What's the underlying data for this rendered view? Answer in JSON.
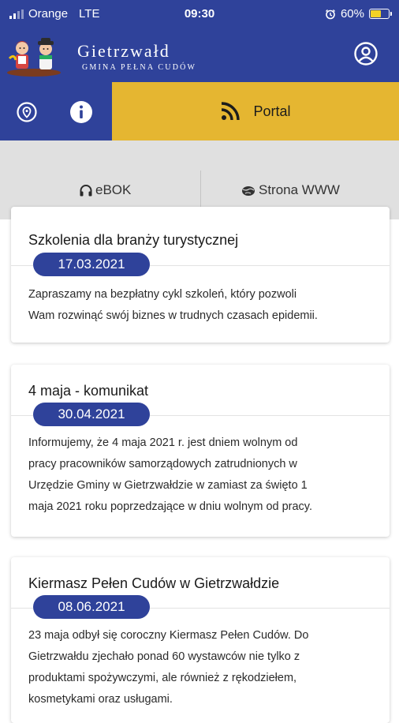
{
  "status_bar": {
    "carrier": "Orange",
    "network": "LTE",
    "time": "09:30",
    "battery_percent": "60%",
    "battery_level": 0.6
  },
  "header": {
    "title": "Gietrzwałd",
    "subtitle": "GMINA PEŁNA CUDÓW",
    "icons": {
      "profile": "user-circle-icon"
    }
  },
  "nav": {
    "icons": {
      "location": "map-pin-icon",
      "info": "info-icon",
      "portal": "rss-icon"
    },
    "portal_label": "Portal"
  },
  "subnav": {
    "ebok_label": "eBOK",
    "www_label": "Strona WWW",
    "icons": {
      "ebok": "headphones-icon",
      "www": "globe-icon"
    }
  },
  "news": [
    {
      "title": "Szkolenia dla branży turystycznej",
      "date": "17.03.2021",
      "lines": [
        "Zapraszamy na bezpłatny cykl szkoleń, który pozwoli",
        "Wam rozwinąć swój biznes w trudnych czasach epidemii."
      ]
    },
    {
      "title": "4 maja - komunikat",
      "date": "30.04.2021",
      "lines": [
        "Informujemy, że 4 maja 2021 r. jest dniem wolnym od",
        "pracy pracowników samorządowych zatrudnionych w",
        "Urzędzie Gminy w Gietrzwałdzie w zamiast za święto 1",
        "maja 2021 roku poprzedzające w dniu wolnym od pracy."
      ]
    },
    {
      "title": "Kiermasz Pełen Cudów w Gietrzwałdzie",
      "date": "08.06.2021",
      "lines": [
        "23 maja odbył się coroczny Kiermasz Pełen Cudów. Do",
        "Gietrzwałdu zjechało ponad 60 wystawców nie tylko z",
        "produktami spożywczymi, ale również z rękodziełem,",
        "kosmetykami oraz usługami."
      ]
    }
  ],
  "colors": {
    "primary": "#2f429a",
    "accent": "#e5b631",
    "subbar": "#e0e0e0"
  }
}
